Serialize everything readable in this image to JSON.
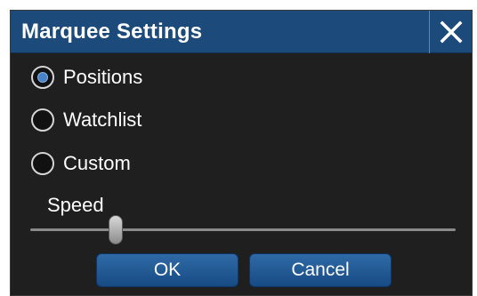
{
  "dialog": {
    "title": "Marquee Settings",
    "close_icon": "close-icon"
  },
  "options": [
    {
      "label": "Positions",
      "selected": true
    },
    {
      "label": "Watchlist",
      "selected": false
    },
    {
      "label": "Custom",
      "selected": false
    }
  ],
  "speed": {
    "label": "Speed",
    "value_fraction": 0.2
  },
  "buttons": {
    "ok": "OK",
    "cancel": "Cancel"
  },
  "colors": {
    "titlebar": "#1c4a7b",
    "dialog_bg": "#1f1f1f",
    "radio_selected": "#4a82c8",
    "button": "#2f6aa6"
  }
}
